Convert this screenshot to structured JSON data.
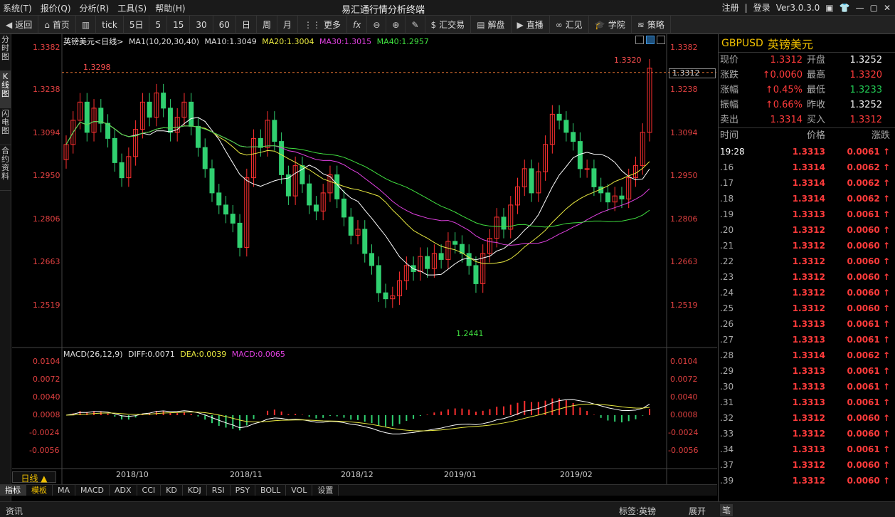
{
  "menu": [
    "系统(T)",
    "报价(Q)",
    "分析(R)",
    "工具(S)",
    "帮助(H)"
  ],
  "app_title": "易汇通行情分析终端",
  "title_right": {
    "register": "注册",
    "login": "登录",
    "version": "Ver3.0.3.0"
  },
  "toolbar": [
    "返回",
    "首页",
    "",
    "tick",
    "5日",
    "5",
    "15",
    "30",
    "60",
    "日",
    "周",
    "月",
    "更多",
    "",
    "",
    "",
    "",
    "汇交易",
    "解盘",
    "直播",
    "汇见",
    "学院",
    "策略"
  ],
  "left_tabs": [
    "分时图",
    "K线图",
    "闪电图",
    "合约资料"
  ],
  "chart": {
    "name": "英镑美元<日线>",
    "ma_legend": {
      "ma1": "MA1(10,20,30,40)",
      "ma10": "MA10:1.3049",
      "ma20": "MA20:1.3004",
      "ma30": "MA30:1.3015",
      "ma40": "MA40:1.2957"
    },
    "macd_legend": {
      "name": "MACD(26,12,9)",
      "diff": "DIFF:0.0071",
      "dea": "DEA:0.0039",
      "macd": "MACD:0.0065"
    },
    "price_axis": [
      "1.3382",
      "1.3238",
      "1.3094",
      "1.2950",
      "1.2806",
      "1.2663",
      "1.2519"
    ],
    "macd_axis": [
      "0.0104",
      "0.0072",
      "0.0040",
      "0.0008",
      "-0.0024",
      "-0.0056"
    ],
    "x_axis": [
      "2018/10",
      "2018/11",
      "2018/12",
      "2019/01",
      "2019/02"
    ],
    "high_label": "1.3298",
    "high_label2": "1.3320",
    "low_label": "1.2441",
    "current_price_box": "1.3312",
    "period": "日线 ▲"
  },
  "bottom_tabs": [
    "指标",
    "模板",
    "MA",
    "MACD",
    "ADX",
    "CCI",
    "KD",
    "KDJ",
    "RSI",
    "PSY",
    "BOLL",
    "VOL",
    "设置"
  ],
  "status": {
    "news": "资讯",
    "tag": "标签:英镑",
    "expand": "展开"
  },
  "quote": {
    "symbol": "GBPUSD",
    "name": "英镑美元",
    "rows": [
      [
        "现价",
        "1.3312",
        "开盘",
        "1.3252"
      ],
      [
        "涨跌",
        "0.0060",
        "最高",
        "1.3320"
      ],
      [
        "涨幅",
        "0.45%",
        "最低",
        "1.3233"
      ],
      [
        "振幅",
        "0.66%",
        "昨收",
        "1.3252"
      ],
      [
        "卖出",
        "1.3314",
        "买入",
        "1.3312"
      ]
    ],
    "tick_headers": [
      "时间",
      "价格",
      "涨跌"
    ],
    "ticks": [
      [
        "19:28",
        "1.3313",
        "0.0061"
      ],
      [
        ".16",
        "1.3314",
        "0.0062"
      ],
      [
        ".17",
        "1.3314",
        "0.0062"
      ],
      [
        ".18",
        "1.3314",
        "0.0062"
      ],
      [
        ".19",
        "1.3313",
        "0.0061"
      ],
      [
        ".20",
        "1.3312",
        "0.0060"
      ],
      [
        ".21",
        "1.3312",
        "0.0060"
      ],
      [
        ".22",
        "1.3312",
        "0.0060"
      ],
      [
        ".23",
        "1.3312",
        "0.0060"
      ],
      [
        ".24",
        "1.3312",
        "0.0060"
      ],
      [
        ".25",
        "1.3312",
        "0.0060"
      ],
      [
        ".26",
        "1.3313",
        "0.0061"
      ],
      [
        ".27",
        "1.3313",
        "0.0061"
      ],
      [
        ".28",
        "1.3314",
        "0.0062"
      ],
      [
        ".29",
        "1.3313",
        "0.0061"
      ],
      [
        ".30",
        "1.3313",
        "0.0061"
      ],
      [
        ".31",
        "1.3313",
        "0.0061"
      ],
      [
        ".32",
        "1.3312",
        "0.0060"
      ],
      [
        ".33",
        "1.3312",
        "0.0060"
      ],
      [
        ".34",
        "1.3313",
        "0.0061"
      ],
      [
        ".37",
        "1.3312",
        "0.0060"
      ],
      [
        ".39",
        "1.3312",
        "0.0060"
      ]
    ]
  },
  "chart_data": {
    "type": "candlestick",
    "title": "英镑美元<日线>",
    "ylim": [
      1.2441,
      1.3382
    ],
    "x_ticks": [
      "2018/10",
      "2018/11",
      "2018/12",
      "2019/01",
      "2019/02"
    ],
    "closes": [
      1.306,
      1.314,
      1.32,
      1.31,
      1.318,
      1.313,
      1.308,
      1.3,
      1.295,
      1.302,
      1.311,
      1.32,
      1.315,
      1.323,
      1.318,
      1.31,
      1.315,
      1.32,
      1.312,
      1.305,
      1.298,
      1.29,
      1.286,
      1.283,
      1.28,
      1.272,
      1.295,
      1.308,
      1.305,
      1.314,
      1.307,
      1.296,
      1.289,
      1.299,
      1.293,
      1.286,
      1.284,
      1.29,
      1.296,
      1.288,
      1.282,
      1.276,
      1.278,
      1.27,
      1.266,
      1.257,
      1.255,
      1.256,
      1.261,
      1.266,
      1.264,
      1.269,
      1.265,
      1.27,
      1.268,
      1.274,
      1.273,
      1.27,
      1.266,
      1.26,
      1.27,
      1.275,
      1.282,
      1.278,
      1.286,
      1.292,
      1.298,
      1.29,
      1.297,
      1.306,
      1.316,
      1.314,
      1.31,
      1.307,
      1.298,
      1.298,
      1.292,
      1.29,
      1.287,
      1.289,
      1.288,
      1.295,
      1.299,
      1.31,
      1.3312
    ]
  }
}
